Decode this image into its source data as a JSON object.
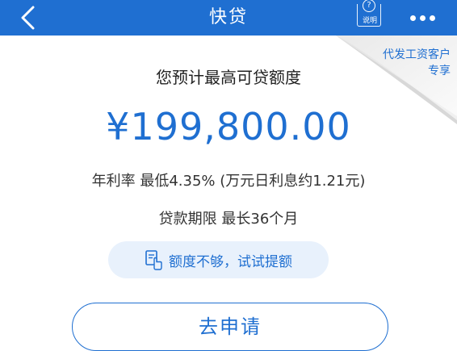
{
  "header": {
    "title": "快贷",
    "help_label": "说明",
    "help_symbol": "?"
  },
  "corner_badge": {
    "line1": "代发工资客户",
    "line2": "专享"
  },
  "main": {
    "subtitle": "您预计最高可贷额度",
    "amount": "¥199,800.00",
    "rate_text": "年利率 最低4.35% (万元日利息约1.21元)",
    "term_text": "贷款期限 最长36个月",
    "raise_limit_label": "额度不够，试试提额",
    "apply_button_label": "去申请"
  },
  "colors": {
    "brand_blue": "#1f6fd1",
    "pill_bg": "#e8f1fc"
  },
  "icons": {
    "back": "chevron-left-icon",
    "help": "help-doc-icon",
    "more": "more-dots-icon",
    "raise": "tap-document-icon"
  }
}
